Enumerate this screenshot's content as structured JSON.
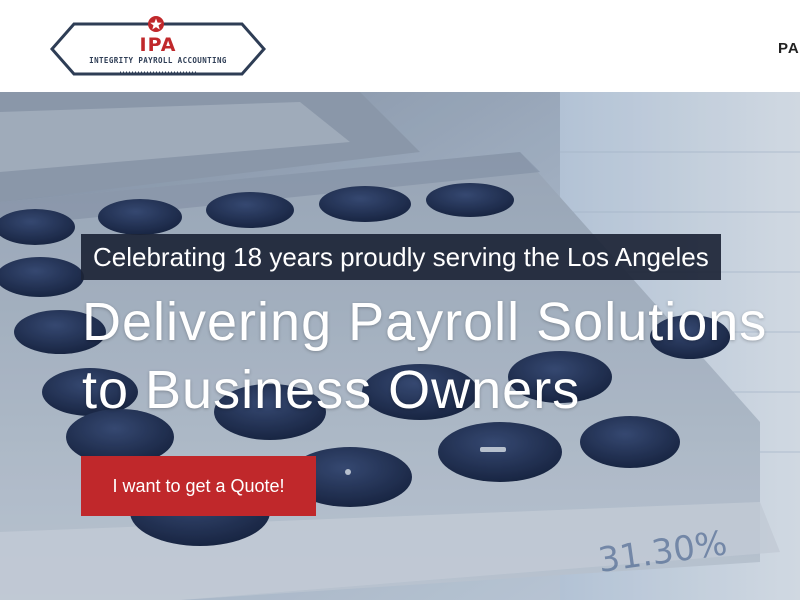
{
  "logo": {
    "abbreviation": "IPA",
    "name": "INTEGRITY PAYROLL ACCOUNTING"
  },
  "nav": {
    "item_label": "PA"
  },
  "hero": {
    "tagline": "Celebrating 18 years proudly serving the Los Angeles",
    "headline_line1": "Delivering Payroll Solutions",
    "headline_line2": "to Business Owners",
    "cta_label": "I want to get a Quote!"
  },
  "colors": {
    "accent_red": "#c0282b",
    "logo_navy": "#2e3d55",
    "tagline_bg": "#1c2436"
  }
}
